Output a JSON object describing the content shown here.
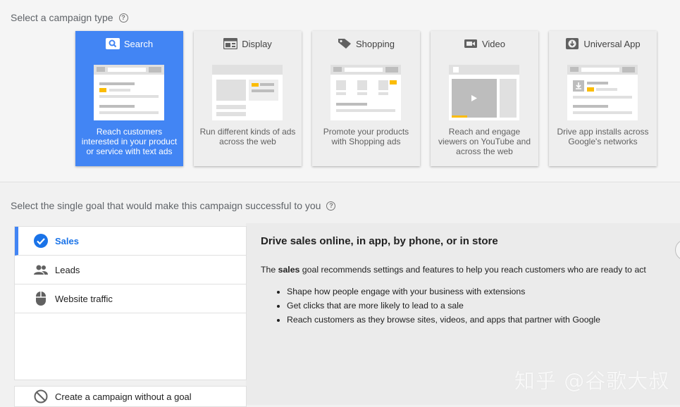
{
  "campaign_type": {
    "label": "Select a campaign type",
    "help_icon": "help-circle-icon",
    "cards": [
      {
        "id": "search",
        "title": "Search",
        "icon": "search-icon",
        "description": "Reach customers interested in your product or service with text ads",
        "selected": true
      },
      {
        "id": "display",
        "title": "Display",
        "icon": "display-icon",
        "description": "Run different kinds of ads across the web",
        "selected": false
      },
      {
        "id": "shopping",
        "title": "Shopping",
        "icon": "shopping-tag-icon",
        "description": "Promote your products with Shopping ads",
        "selected": false
      },
      {
        "id": "video",
        "title": "Video",
        "icon": "video-camera-icon",
        "description": "Reach and engage viewers on YouTube and across the web",
        "selected": false
      },
      {
        "id": "universal_app",
        "title": "Universal App",
        "icon": "app-download-icon",
        "description": "Drive app installs across Google's networks",
        "selected": false
      }
    ]
  },
  "goal": {
    "label": "Select the single goal that would make this campaign successful to you",
    "items": [
      {
        "label": "Sales",
        "icon": "check-circle-icon",
        "active": true
      },
      {
        "label": "Leads",
        "icon": "people-icon",
        "active": false
      },
      {
        "label": "Website traffic",
        "icon": "mouse-icon",
        "active": false
      }
    ],
    "no_goal_label": "Create a campaign without a goal",
    "panel": {
      "title": "Drive sales online, in app, by phone, or in store",
      "intro_prefix": "The ",
      "intro_bold": "sales",
      "intro_suffix": " goal recommends settings and features to help you reach customers who are ready to act",
      "bullets": [
        "Shape how people engage with your business with extensions",
        "Get clicks that are more likely to lead to a sale",
        "Reach customers as they browse sites, videos, and apps that partner with Google"
      ]
    }
  },
  "watermark": "知乎 @谷歌大叔",
  "colors": {
    "accent": "#4285f4",
    "highlight": "#fbbc04"
  }
}
